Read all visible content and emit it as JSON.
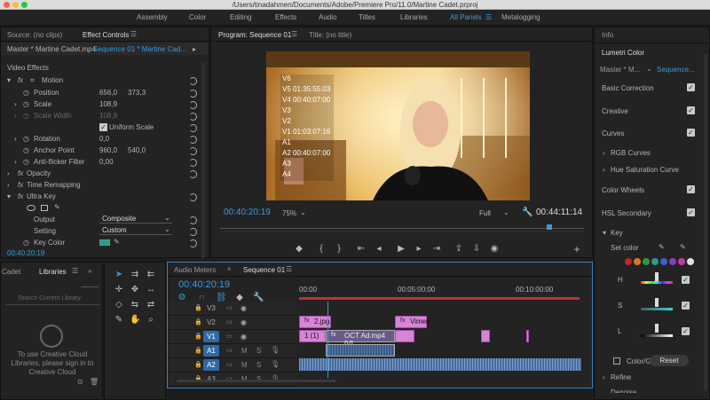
{
  "window": {
    "title": "/Users/tinadahmen/Documents/Adobe/Premiere Pro/11.0/Martine Cadet.prproj"
  },
  "workspaces": [
    "Assembly",
    "Color",
    "Editing",
    "Effects",
    "Audio",
    "Titles",
    "Libraries",
    "All Panels",
    "Metalogging"
  ],
  "workspace_active": "All Panels",
  "left_panel": {
    "tabs": [
      "Source: (no clips)",
      "Effect Controls"
    ],
    "master_label": "Master * Martine Cadet.mp4",
    "sequence_label": "Sequence 01 * Martine Cad...",
    "section": "Video Effects",
    "motion": "Motion",
    "position_label": "Position",
    "position_x": "656,0",
    "position_y": "373,3",
    "scale_label": "Scale",
    "scale_value": "108,9",
    "scale_width_label": "Scale Width",
    "scale_width_value": "108,9",
    "uniform_scale": "Uniform Scale",
    "rotation_label": "Rotation",
    "rotation_value": "0,0",
    "anchor_label": "Anchor Point",
    "anchor_x": "960,0",
    "anchor_y": "540,0",
    "antiflicker_label": "Anti-flicker Filter",
    "antiflicker_value": "0,00",
    "opacity": "Opacity",
    "time_remap": "Time Remapping",
    "ultra_key": "Ultra Key",
    "output_label": "Output",
    "output_value": "Composite",
    "setting_label": "Setting",
    "setting_value": "Custom",
    "key_color_label": "Key Color",
    "key_color": "#1aa394",
    "timecode": "00:40:20:19"
  },
  "program": {
    "tabs": [
      "Program: Sequence 01",
      "Title: (no title)"
    ],
    "overlay_lines": [
      "V6",
      "V5 01:35:55:03",
      "V4 00:40:07:00",
      "V3",
      "V2",
      "V1 01:03:07:16",
      "A1",
      "A2 00:40:07:00",
      "A3",
      "A4"
    ],
    "timecode": "00:40:20:19",
    "zoom": "75%",
    "quality": "Full",
    "duration": "00:44:11:14"
  },
  "libraries": {
    "tabs": [
      "Cadet",
      "Libraries"
    ],
    "search_placeholder": "Search Current Library",
    "message": "To use Creative Cloud Libraries, please sign in to Creative Cloud"
  },
  "timeline": {
    "tabs": [
      "Audio Meters",
      "Sequence 01"
    ],
    "timecode": "00:40:20:19",
    "ruler": [
      "00:00",
      "00:05:00:00",
      "00:10:00:00"
    ],
    "tracks": [
      {
        "name": "V3",
        "kind": "v"
      },
      {
        "name": "V2",
        "kind": "v"
      },
      {
        "name": "V1",
        "kind": "v"
      },
      {
        "name": "A1",
        "kind": "a"
      },
      {
        "name": "A2",
        "kind": "a"
      },
      {
        "name": "A3",
        "kind": "a"
      }
    ],
    "clips": {
      "v2_a": "2.jpg",
      "v2_b": "Vimeo",
      "v1_a": "1 (1)",
      "v1_b": "OCT Ad.mp4 [V]"
    },
    "track_toggles": {
      "mute": "M",
      "solo": "S"
    }
  },
  "lumetri": {
    "info_tab": "Info",
    "title": "Lumetri Color",
    "master_label": "Master * M...",
    "sequence_label": "Sequence...",
    "sections": [
      "Basic Correction",
      "Creative",
      "Curves"
    ],
    "subsections": [
      "RGB Curves",
      "Hue Saturation Curve"
    ],
    "color_wheels": "Color Wheels",
    "hsl": "HSL Secondary",
    "key": "Key",
    "set_color": "Set color",
    "hsl_letters": [
      "H",
      "S",
      "L"
    ],
    "swatches": [
      "#c0262c",
      "#d47a1f",
      "#2c9a3a",
      "#2d9b91",
      "#3c62c8",
      "#8a3cc2",
      "#c43a9e",
      "#e0e0e0"
    ],
    "color_gray": "Color/Gray",
    "reset": "Reset",
    "refine": "Refine",
    "denoise": "Denoise"
  },
  "colors": {
    "accent": "#3a9ad9",
    "clip_video": "#d884d6",
    "clip_audio": "#4a6a9a",
    "playhead": "#3a9ad9"
  }
}
